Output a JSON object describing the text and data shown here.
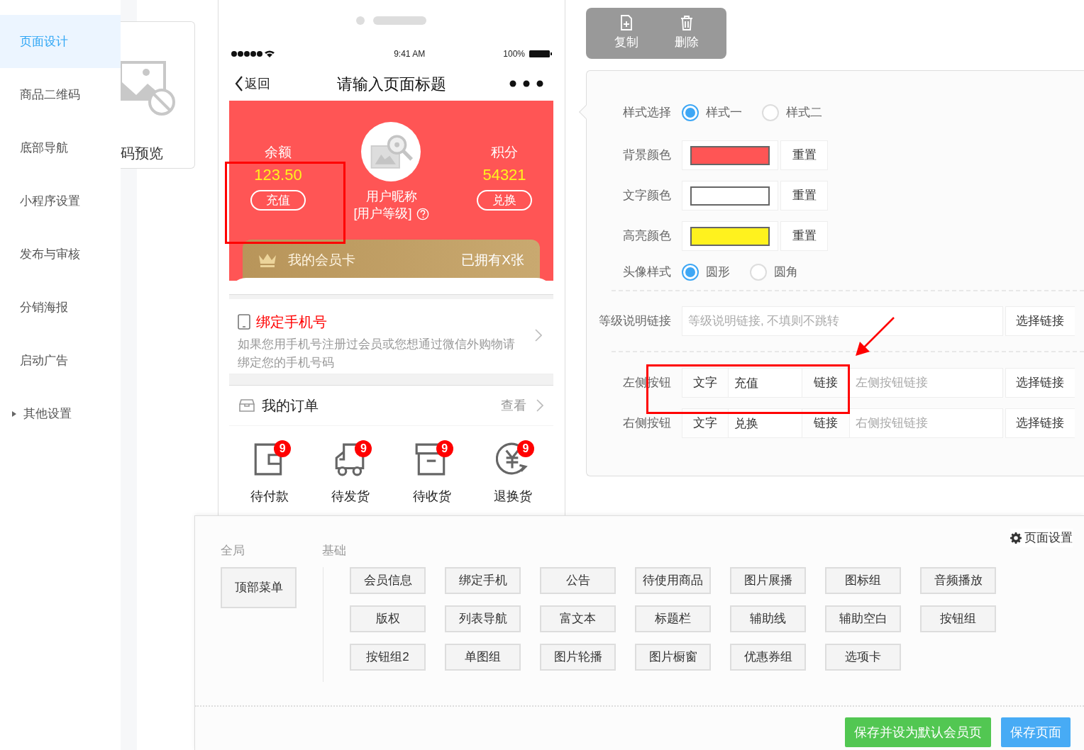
{
  "sidebar": {
    "items": [
      {
        "kind": "link",
        "label": "页面设计",
        "selected": true
      },
      {
        "kind": "link",
        "label": "商品二维码",
        "selected": false
      },
      {
        "kind": "link",
        "label": "底部导航",
        "selected": false
      },
      {
        "kind": "link",
        "label": "小程序设置",
        "selected": false
      },
      {
        "kind": "link",
        "label": "发布与审核",
        "selected": false
      },
      {
        "kind": "link",
        "label": "分销海报",
        "selected": false
      },
      {
        "kind": "link",
        "label": "启动广告",
        "selected": false
      },
      {
        "kind": "group",
        "label": "其他设置",
        "selected": false,
        "expanded": false
      }
    ]
  },
  "preview_card": {
    "label": "码预览"
  },
  "phone": {
    "status_bar": {
      "time": "9:41 AM",
      "battery": "100%"
    },
    "nav": {
      "back": "返回",
      "title": "请输入页面标题"
    },
    "member": {
      "left": {
        "label": "余额",
        "value": "123.50",
        "button": "充值"
      },
      "nickname": "用户昵称",
      "level": "[用户等级]",
      "right": {
        "label": "积分",
        "value": "54321",
        "button": "兑换"
      },
      "card": {
        "title": "我的会员卡",
        "count": "已拥有X张"
      }
    },
    "bind_phone": {
      "title": "绑定手机号",
      "description": "如果您用手机号注册过会员或您想通过微信外购物请绑定您的手机号码"
    },
    "orders": {
      "title": "我的订单",
      "link": "查看",
      "items": [
        {
          "kind": "wallet",
          "label": "待付款",
          "badge": "9"
        },
        {
          "kind": "truck",
          "label": "待发货",
          "badge": "9"
        },
        {
          "kind": "box",
          "label": "待收货",
          "badge": "9"
        },
        {
          "kind": "refund",
          "label": "退换货",
          "badge": "9"
        }
      ]
    }
  },
  "toolbar": [
    {
      "kind": "copy",
      "label": "复制"
    },
    {
      "kind": "delete",
      "label": "删除"
    }
  ],
  "settings": {
    "style": {
      "label": "样式选择",
      "options": [
        {
          "label": "样式一",
          "selected": true
        },
        {
          "label": "样式二",
          "selected": false
        }
      ]
    },
    "colors": [
      {
        "label": "背景颜色",
        "color": "#ff5555",
        "button": "重置"
      },
      {
        "label": "文字颜色",
        "color": "#ffffff",
        "button": "重置"
      },
      {
        "label": "高亮颜色",
        "color": "#fff21e",
        "button": "重置"
      }
    ],
    "avatar": {
      "label": "头像样式",
      "options": [
        {
          "label": "圆形",
          "selected": true
        },
        {
          "label": "圆角",
          "selected": false
        }
      ]
    },
    "level_link": {
      "label": "等级说明链接",
      "placeholder": "等级说明链接, 不填则不跳转",
      "button": "选择链接"
    },
    "side_buttons": [
      {
        "label": "左侧按钮",
        "text_label": "文字",
        "text_value": "充值",
        "link_label": "链接",
        "placeholder": "左侧按钮链接",
        "button": "选择链接"
      },
      {
        "label": "右侧按钮",
        "text_label": "文字",
        "text_value": "兑换",
        "link_label": "链接",
        "placeholder": "右侧按钮链接",
        "button": "选择链接"
      }
    ]
  },
  "components": {
    "page_settings": "页面设置",
    "global": {
      "title": "全局",
      "items": [
        "顶部菜单"
      ]
    },
    "basic": {
      "title": "基础",
      "items": [
        "会员信息",
        "绑定手机",
        "公告",
        "待使用商品",
        "图片展播",
        "图标组",
        "音频播放",
        "版权",
        "列表导航",
        "富文本",
        "标题栏",
        "辅助线",
        "辅助空白",
        "按钮组",
        "按钮组2",
        "单图组",
        "图片轮播",
        "图片橱窗",
        "优惠券组",
        "选项卡"
      ]
    },
    "actions": [
      {
        "kind": "success",
        "label": "保存并设为默认会员页"
      },
      {
        "kind": "primary",
        "label": "保存页面"
      }
    ]
  }
}
